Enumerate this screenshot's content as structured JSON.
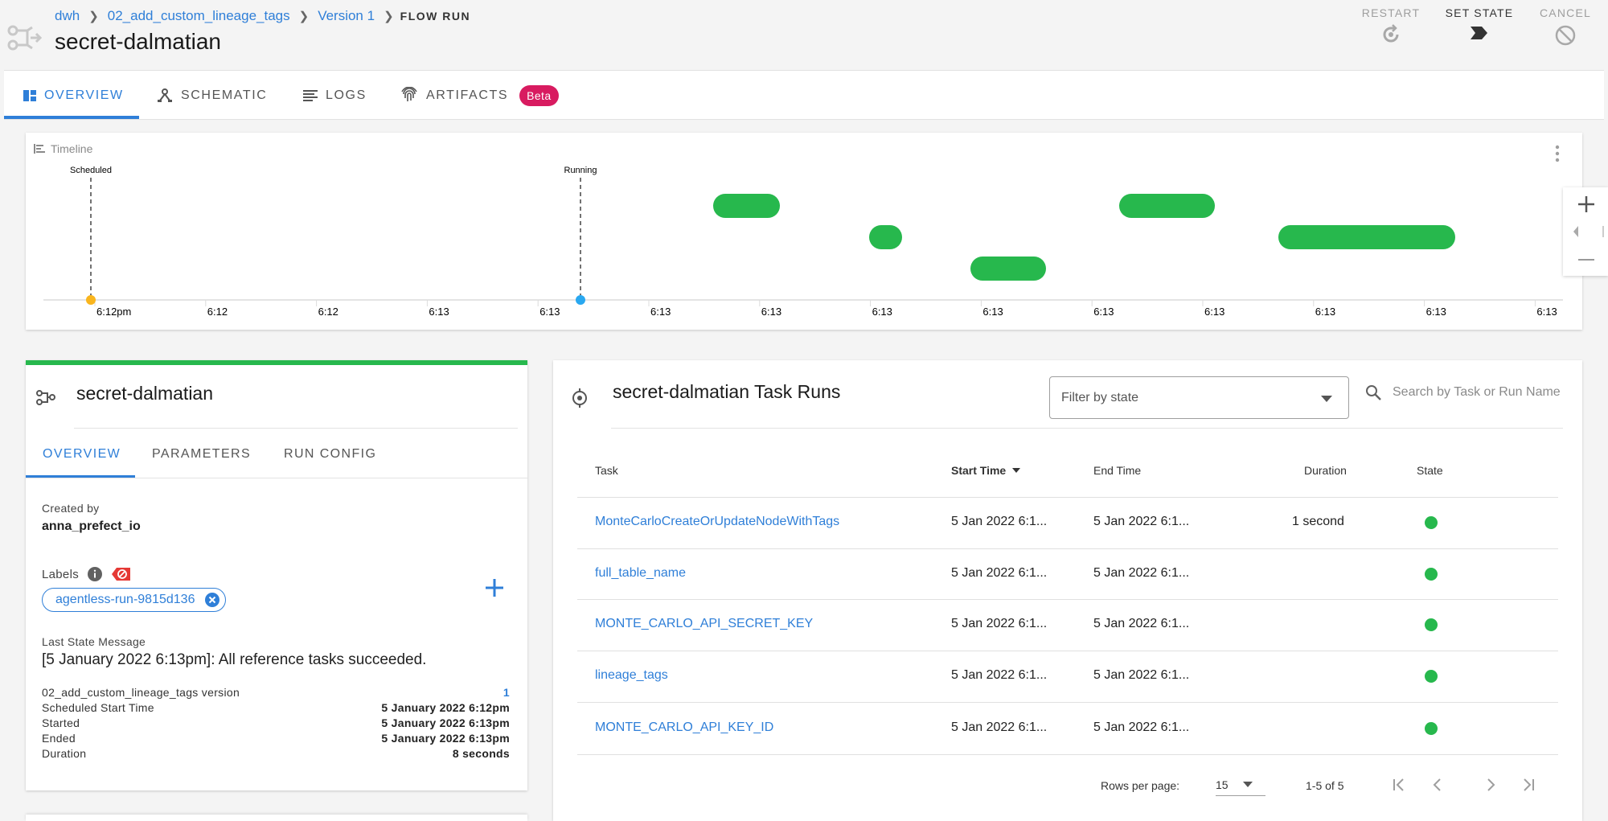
{
  "header": {
    "breadcrumb": [
      {
        "label": "dwh"
      },
      {
        "label": "02_add_custom_lineage_tags"
      },
      {
        "label": "Version 1"
      }
    ],
    "breadcrumb_current": "FLOW RUN",
    "title": "secret-dalmatian",
    "actions": {
      "restart": "RESTART",
      "set_state": "SET STATE",
      "cancel": "CANCEL"
    }
  },
  "tabs": {
    "overview": "OVERVIEW",
    "schematic": "SCHEMATIC",
    "logs": "LOGS",
    "artifacts": "ARTIFACTS",
    "artifacts_badge": "Beta"
  },
  "timeline": {
    "title": "Timeline",
    "markers": [
      {
        "label": "Scheduled",
        "color": "#f9b51d"
      },
      {
        "label": "Running",
        "color": "#29a8f0"
      }
    ],
    "tick_labels": [
      "6:12pm",
      "6:12",
      "6:12",
      "6:13",
      "6:13",
      "6:13",
      "6:13",
      "6:13",
      "6:13",
      "6:13",
      "6:13",
      "6:13",
      "6:13",
      "6:13"
    ],
    "bar_color": "#27b84d"
  },
  "run_detail": {
    "title": "secret-dalmatian",
    "tabs": {
      "overview": "OVERVIEW",
      "parameters": "PARAMETERS",
      "run_config": "RUN CONFIG"
    },
    "created_by_label": "Created by",
    "created_by": "anna_prefect_io",
    "labels_label": "Labels",
    "labels": [
      "agentless-run-9815d136"
    ],
    "last_state_message_label": "Last State Message",
    "last_state_message": "[5 January 2022 6:13pm]: All reference tasks succeeded.",
    "meta": [
      {
        "label": "02_add_custom_lineage_tags version",
        "value": "1"
      },
      {
        "label": "Scheduled Start Time",
        "value": "5 January 2022 6:12pm"
      },
      {
        "label": "Started",
        "value": "5 January 2022 6:13pm"
      },
      {
        "label": "Ended",
        "value": "5 January 2022 6:13pm"
      },
      {
        "label": "Duration",
        "value": "8 seconds"
      }
    ]
  },
  "task_runs": {
    "title": "secret-dalmatian Task Runs",
    "filter_placeholder": "Filter by state",
    "search_placeholder": "Search by Task or Run Name",
    "columns": [
      "Task",
      "Start Time",
      "End Time",
      "Duration",
      "State"
    ],
    "rows": [
      {
        "task": "MonteCarloCreateOrUpdateNodeWithTags",
        "start": "5 Jan 2022 6:1...",
        "end": "5 Jan 2022 6:1...",
        "duration": "1 second",
        "state": "Success"
      },
      {
        "task": "full_table_name",
        "start": "5 Jan 2022 6:1...",
        "end": "5 Jan 2022 6:1...",
        "duration": "",
        "state": "Success"
      },
      {
        "task": "MONTE_CARLO_API_SECRET_KEY",
        "start": "5 Jan 2022 6:1...",
        "end": "5 Jan 2022 6:1...",
        "duration": "",
        "state": "Success"
      },
      {
        "task": "lineage_tags",
        "start": "5 Jan 2022 6:1...",
        "end": "5 Jan 2022 6:1...",
        "duration": "",
        "state": "Success"
      },
      {
        "task": "MONTE_CARLO_API_KEY_ID",
        "start": "5 Jan 2022 6:1...",
        "end": "5 Jan 2022 6:1...",
        "duration": "",
        "state": "Success"
      }
    ],
    "state_color": "#27b84d",
    "pagination": {
      "rows_per_page_label": "Rows per page:",
      "rows_per_page": "15",
      "range": "1-5 of 5"
    }
  },
  "colors": {
    "accent": "#2f7fd8",
    "success": "#27b84d",
    "badge": "#d81b60"
  }
}
